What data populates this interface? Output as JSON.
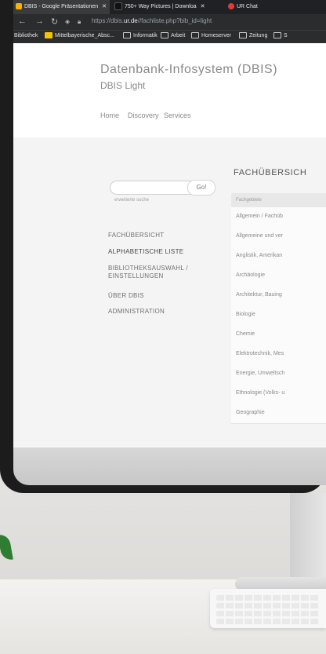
{
  "browser": {
    "tabs": [
      {
        "label": "DBIS - Google Präsentationen",
        "close": "✕",
        "color": "#f4b400"
      },
      {
        "label": "750+ Way Pictures | Downloa",
        "close": "✕",
        "color": "#222222"
      },
      {
        "label": "UR Chat",
        "color": "#e53935"
      }
    ],
    "url_prefix": "https://dbis.",
    "url_domain": "ur.de",
    "url_suffix": "//fachliste.php?bib_id=light",
    "bookmarks": [
      "Bibliothek",
      "Mittelbayerische_Absc...",
      "Informatik",
      "Arbeit",
      "Homeserver",
      "Zeitung",
      "S"
    ]
  },
  "site": {
    "title": "Datenbank-Infosystem (DBIS)",
    "subtitle": "DBIS Light",
    "nav": [
      "Home",
      "Discovery",
      "Services"
    ]
  },
  "search": {
    "go_label": "Go!",
    "advanced_label": "erweiterte suche"
  },
  "menu": [
    "FACHÜBERSICHT",
    "ALPHABETISCHE LISTE",
    "BIBLIOTHEKSAUSWAHL / EINSTELLUNGEN",
    "ÜBER DBIS",
    "ADMINISTRATION"
  ],
  "main": {
    "heading": "FACHÜBERSICH",
    "table_header": "Fachgebiete",
    "rows": [
      "Allgemein / Fachüb",
      "Allgemeine und ver",
      "Anglistik, Amerikan",
      "Archäologie",
      "Architektur, Bauing",
      "Biologie",
      "Chemie",
      "Elektrotechnik, Mes",
      "Energie, Umweltsch",
      "Ethnologie (Volks- u",
      "Geographie"
    ]
  }
}
